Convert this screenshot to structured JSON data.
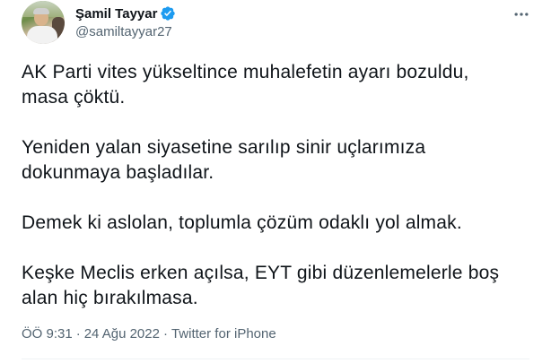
{
  "tweet": {
    "author": {
      "display_name": "Şamil Tayyar",
      "handle": "@samiltayyar27",
      "verified": true,
      "avatar_icon": "profile-photo"
    },
    "body": "AK Parti vites yükseltince muhalefetin ayarı bozuldu,\nmasa çöktü.\n\nYeniden yalan siyasetine sarılıp sinir uçlarımıza\ndokunmaya başladılar.\n\nDemek ki aslolan, toplumla çözüm odaklı yol almak.\n\nKeşke Meclis erken açılsa, EYT gibi düzenlemelerle boş\nalan hiç bırakılmasa.",
    "time": "ÖÖ 9:31",
    "separator1": "·",
    "date": "24 Ağu 2022",
    "separator2": "·",
    "source": "Twitter for iPhone"
  },
  "icons": {
    "verified": "verified-badge-icon",
    "more": "more-options-icon"
  },
  "colors": {
    "verified_blue": "#1d9bf0",
    "text_primary": "#0f1419",
    "text_secondary": "#536471"
  }
}
